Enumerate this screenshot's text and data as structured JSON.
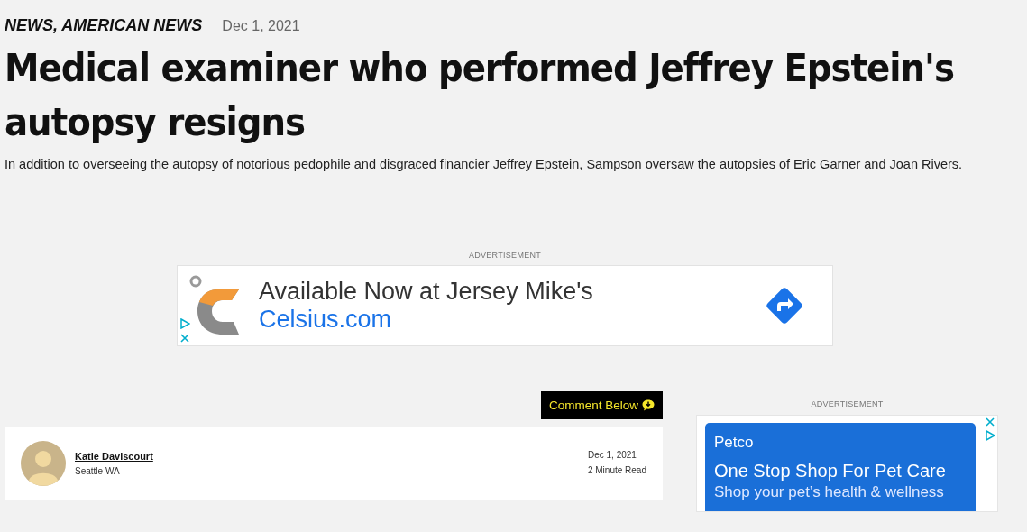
{
  "article": {
    "categories": "NEWS, AMERICAN NEWS",
    "date": "Dec 1, 2021",
    "headline": "Medical examiner who performed Jeffrey Epstein's autopsy resigns",
    "summary": "In addition to overseeing the autopsy of notorious pedophile and disgraced financier Jeffrey Epstein, Sampson oversaw the autopsies of Eric Garner and Joan Rivers."
  },
  "banner_ad": {
    "label": "ADVERTISEMENT",
    "headline": "Available Now at Jersey Mike's",
    "link": "Celsius.com"
  },
  "comment_button": {
    "label": "Comment Below"
  },
  "byline": {
    "author": "Katie Daviscourt",
    "location": "Seattle WA",
    "date": "Dec 1, 2021",
    "read_time": "2 Minute Read"
  },
  "side_ad": {
    "label": "ADVERTISEMENT",
    "advertiser": "Petco",
    "headline": "One Stop Shop For Pet Care",
    "body": "Shop your pet’s health & wellness"
  }
}
